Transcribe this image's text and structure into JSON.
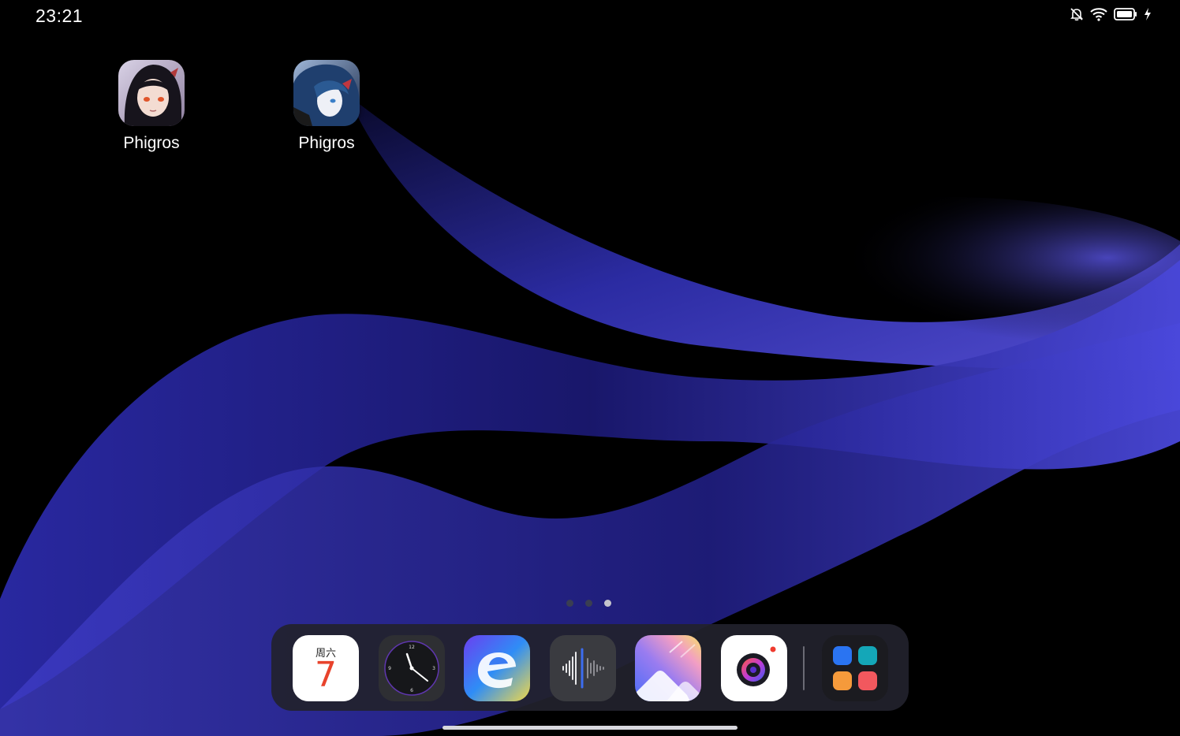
{
  "status_bar": {
    "time": "23:21",
    "icons": [
      "bell-off-icon",
      "wifi-icon",
      "battery-icon",
      "charging-icon"
    ]
  },
  "home_apps": [
    {
      "label": "Phigros",
      "icon": "phigros-icon-red-eyed-girl"
    },
    {
      "label": "Phigros",
      "icon": "phigros-icon-blue-haired-girl"
    }
  ],
  "page_indicator": {
    "pages": 3,
    "active": 3
  },
  "dock": {
    "calendar": {
      "weekday": "周六",
      "day": "7"
    },
    "apps": [
      "calendar-icon",
      "clock-icon",
      "browser-icon",
      "recorder-icon",
      "gallery-icon",
      "camera-icon",
      "app-library-icon"
    ]
  },
  "colors": {
    "accent_blue": "#3a39c9",
    "calendar_red": "#e8432c",
    "background": "#000000"
  }
}
